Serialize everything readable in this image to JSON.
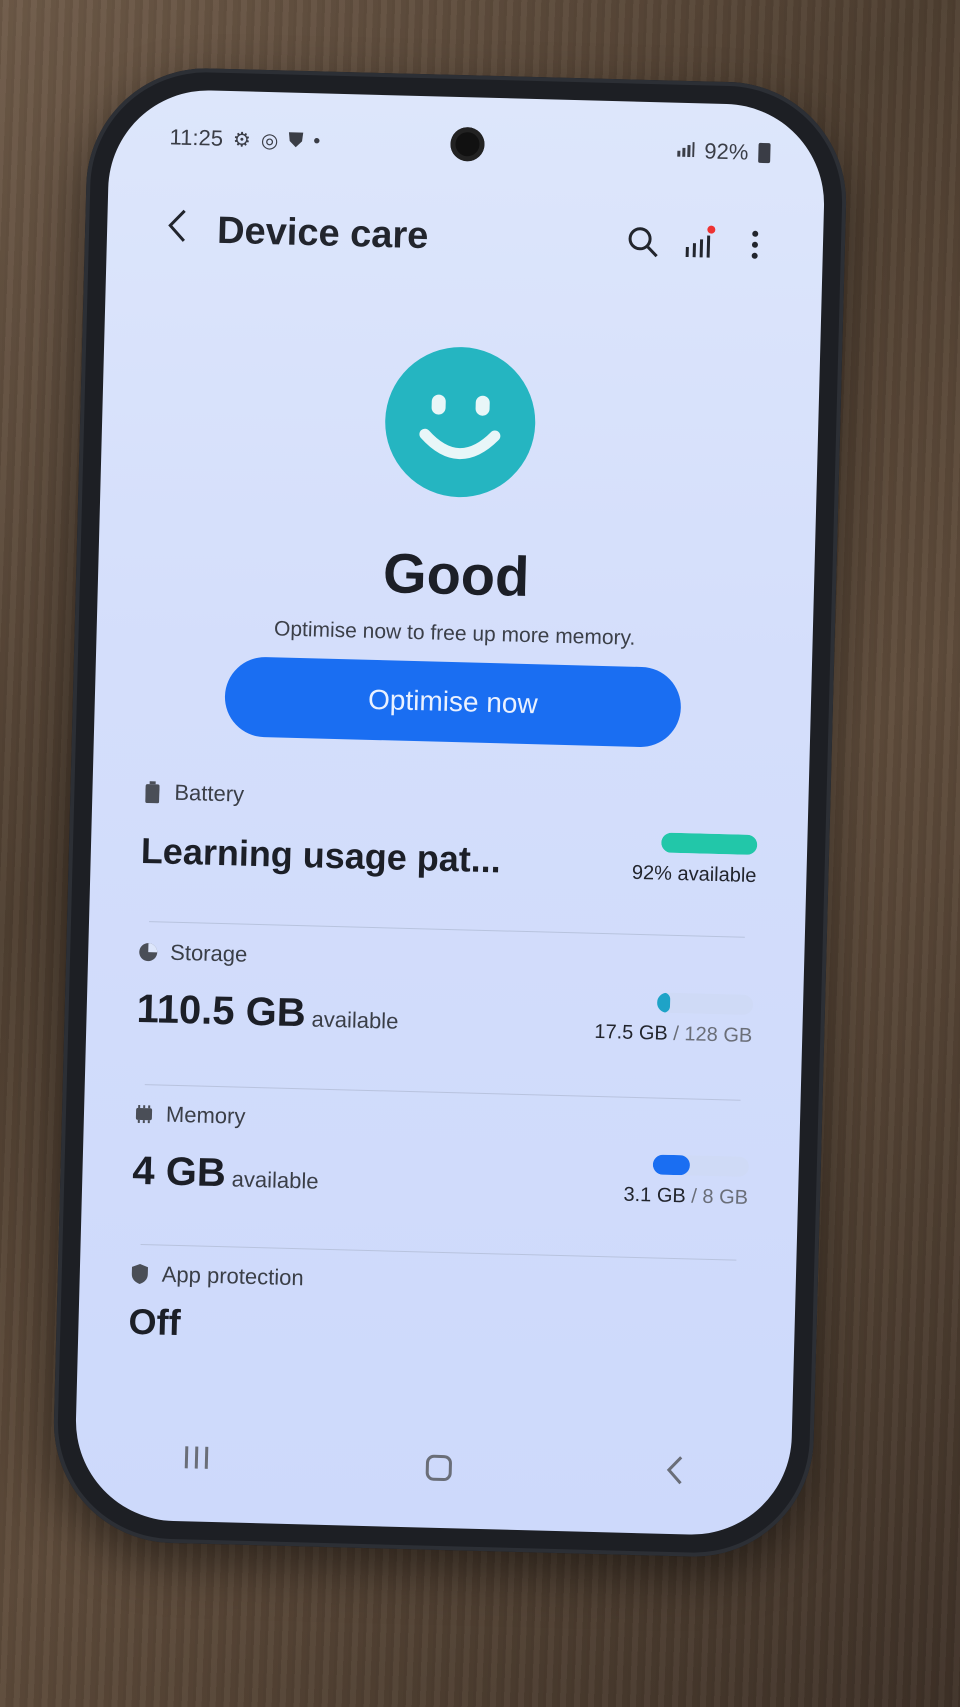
{
  "status_bar": {
    "time": "11:25",
    "battery_percent": "92%"
  },
  "header": {
    "title": "Device care"
  },
  "summary": {
    "status": "Good",
    "subtitle": "Optimise now to free up more memory.",
    "button_label": "Optimise now"
  },
  "battery": {
    "label": "Battery",
    "value": "Learning usage pat...",
    "detail": "92% available",
    "level": 1.0,
    "color": "#22c7a9"
  },
  "storage": {
    "label": "Storage",
    "value": "110.5 GB",
    "unit": "available",
    "used": "17.5 GB",
    "total": "/ 128 GB",
    "level": 0.14,
    "color": "#1ea3c7"
  },
  "memory": {
    "label": "Memory",
    "value": "4 GB",
    "unit": "available",
    "used": "3.1 GB",
    "total": "/ 8 GB",
    "level": 0.39,
    "color": "#1a6ef2"
  },
  "app_protection": {
    "label": "App protection",
    "value": "Off"
  },
  "colors": {
    "accent": "#1a6ef2",
    "smiley": "#25b5c1"
  }
}
